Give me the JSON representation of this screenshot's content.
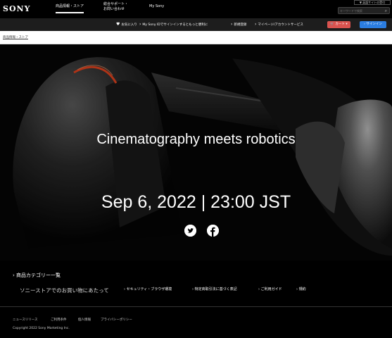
{
  "brand": "SONY",
  "header": {
    "nav": [
      {
        "label": "商品情報・ストア"
      },
      {
        "label": "総合サポート・\nお問い合わせ"
      },
      {
        "label": "My Sony"
      }
    ],
    "language_button": "▼ 英語サイトの受付",
    "search_placeholder": "キーワードで検索",
    "search_icon": "magnifier-icon"
  },
  "utility": {
    "favorites": "お気に入り",
    "my_sony_id": "My Sony IDでサインインするともっと便利に",
    "new_register": "新規登録",
    "my_page": "マイページ/アカウントサービス",
    "cart": "カート",
    "signin": "サインイン"
  },
  "breadcrumb": "商品情報・ストア",
  "hero": {
    "title": "Cinematography meets robotics",
    "date": "Sep 6, 2022 | 23:00 JST",
    "social": [
      "twitter-icon",
      "facebook-icon"
    ],
    "accent_color": "#e8451f"
  },
  "footer": {
    "category": "商品カテゴリー一覧",
    "shopping_note": "ソニーストアでのお買い物にあたって",
    "links": [
      "セキュリティ・ブラウザ環境",
      "特定商取引法に基づく表記",
      "ご利用ガイド",
      "規約"
    ],
    "bottom_links": [
      "ニュースリリース",
      "ご利用条件",
      "個人情報",
      "プライバシーポリシー"
    ],
    "copyright": "Copyright 2022 Sony Marketing Inc."
  }
}
